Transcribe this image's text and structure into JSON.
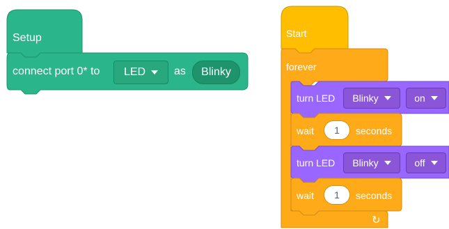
{
  "setup_block": {
    "hat_label": "Setup",
    "connect_prefix": "connect port 0* to",
    "device_value": "LED",
    "as_label": "as",
    "name_value": "Blinky"
  },
  "start_block": {
    "hat_label": "Start",
    "forever_label": "forever",
    "loop_arrow": "↻"
  },
  "statements": [
    {
      "prefix": "turn LED",
      "target_value": "Blinky",
      "state_value": "on"
    },
    {
      "prefix": "wait",
      "number": "1",
      "suffix": "seconds"
    },
    {
      "prefix": "turn LED",
      "target_value": "Blinky",
      "state_value": "off"
    },
    {
      "prefix": "wait",
      "number": "1",
      "suffix": "seconds"
    }
  ],
  "colors": {
    "io_green": "#2bb58a",
    "io_green_border": "#1f946c",
    "event_yellow": "#ffbf00",
    "control_orange": "#ffab19",
    "looks_purple": "#9966ff",
    "wait_orange": "#ffab19"
  },
  "icons": {
    "dropdown": "caret-down-icon",
    "loop": "loop-arrow-icon"
  }
}
